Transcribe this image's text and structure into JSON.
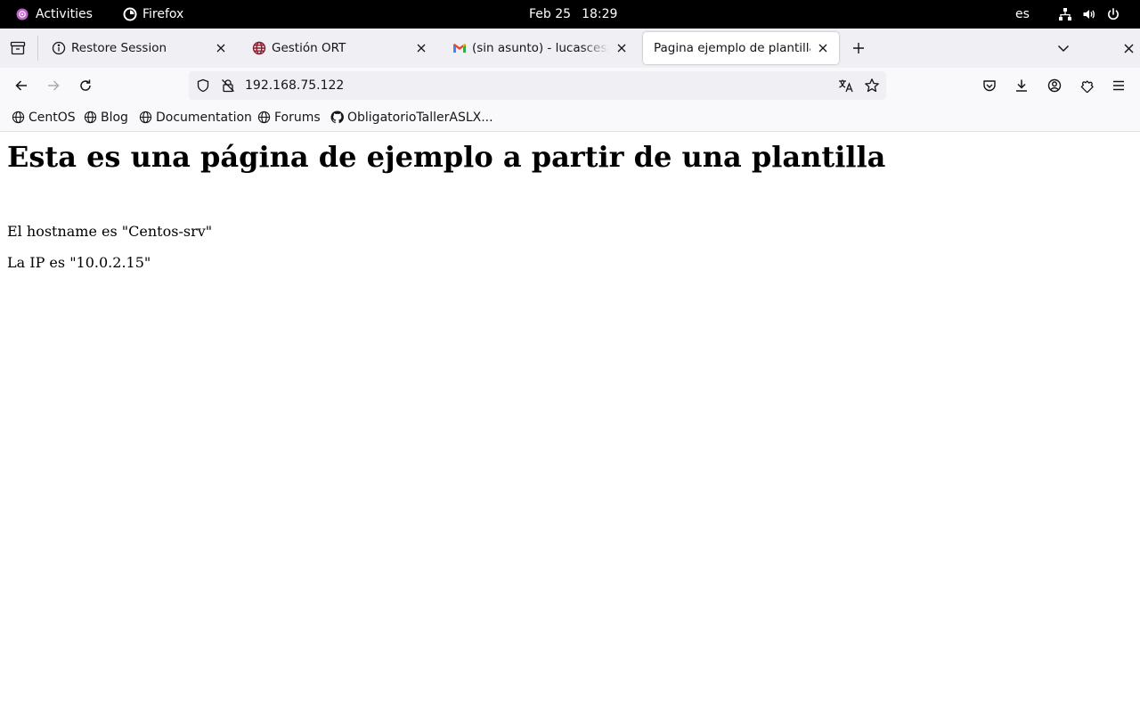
{
  "topbar": {
    "activities": "Activities",
    "app": "Firefox",
    "date": "Feb 25",
    "time": "18:29",
    "lang": "es"
  },
  "tabs": [
    {
      "title": "Restore Session",
      "icon": "info-icon",
      "active": false
    },
    {
      "title": "Gestión ORT",
      "icon": "globe-icon",
      "active": false
    },
    {
      "title": "(sin asunto) - lucascespedes",
      "icon": "gmail-icon",
      "active": false
    },
    {
      "title": "Pagina ejemplo de plantilla",
      "icon": "none",
      "active": true
    }
  ],
  "urlbar": {
    "url": "192.168.75.122"
  },
  "bookmarks": [
    {
      "label": "CentOS",
      "icon": "globe-icon"
    },
    {
      "label": "Blog",
      "icon": "globe-icon"
    },
    {
      "label": "Documentation",
      "icon": "globe-icon"
    },
    {
      "label": "Forums",
      "icon": "globe-icon"
    },
    {
      "label": "ObligatorioTallerASLX...",
      "icon": "github-icon"
    }
  ],
  "page": {
    "heading": "Esta es una página de ejemplo a partir de una plantilla",
    "hostname_line": "El hostname es \"Centos-srv\"",
    "ip_line": "La IP es \"10.0.2.15\""
  },
  "colors": {
    "topbar_bg": "#000000",
    "tabstrip_bg": "#f0f0f4",
    "toolbar_bg": "#f9f9fb",
    "urlbar_bg": "#f0f0f4",
    "gnome_logo": "#c061cb"
  }
}
